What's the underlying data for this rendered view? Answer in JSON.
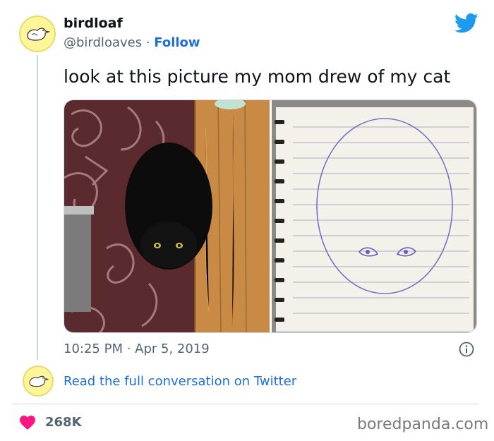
{
  "tweet": {
    "display_name": "birdloaf",
    "handle": "@birdloaves",
    "separator": " · ",
    "follow_label": "Follow",
    "text": "look at this picture my mom drew of my cat",
    "timestamp": "10:25 PM · Apr 5, 2019",
    "read_conversation_label": "Read the full conversation on Twitter",
    "likes": "268K"
  },
  "icons": {
    "twitter": "twitter-bird-icon",
    "info": "info-icon",
    "heart": "heart-icon",
    "avatar": "bird-loaf-avatar"
  },
  "colors": {
    "link_blue": "#1d6fd6",
    "twitter_blue": "#1d9bf0",
    "heart_red": "#f91880",
    "avatar_yellow": "#fff59a",
    "muted_text": "#536471"
  },
  "watermark": "boredpanda.com"
}
